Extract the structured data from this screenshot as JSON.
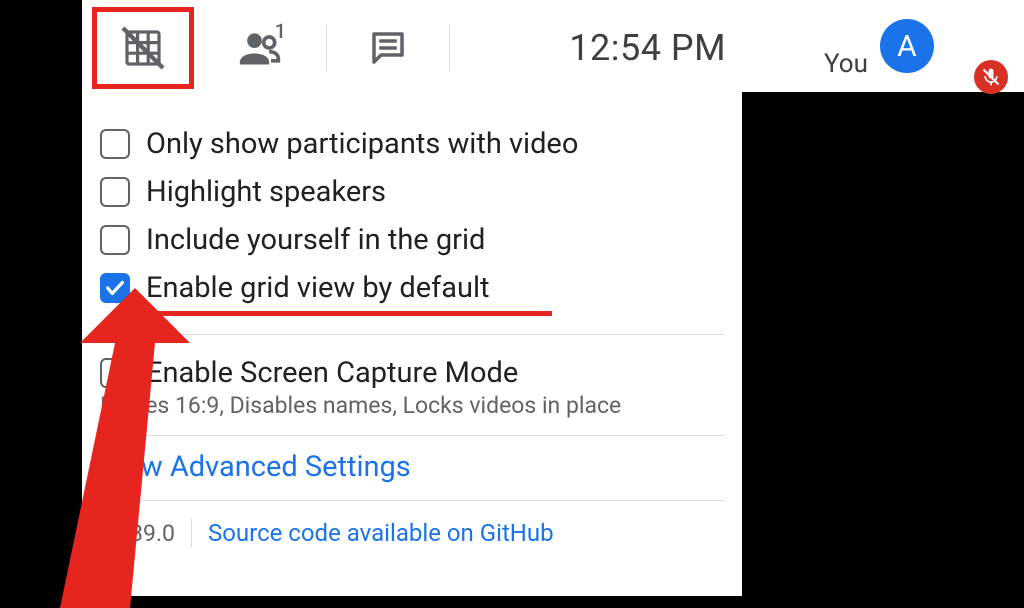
{
  "toolbar": {
    "clock": "12:54 PM"
  },
  "self_tile": {
    "you_label": "You",
    "avatar_letter": "A"
  },
  "options": {
    "items": [
      {
        "label": "Only show participants with video",
        "checked": false
      },
      {
        "label": "Highlight speakers",
        "checked": false
      },
      {
        "label": "Include yourself in the grid",
        "checked": false
      },
      {
        "label": "Enable grid view by default",
        "checked": true
      }
    ],
    "screen_capture": {
      "label": "Enable Screen Capture Mode",
      "caption": "Forces 16:9, Disables names, Locks videos in place",
      "checked": false
    },
    "advanced_link": "View Advanced Settings",
    "version": "v1.39.0",
    "source_link": "Source code available on GitHub"
  },
  "people_count": "1"
}
